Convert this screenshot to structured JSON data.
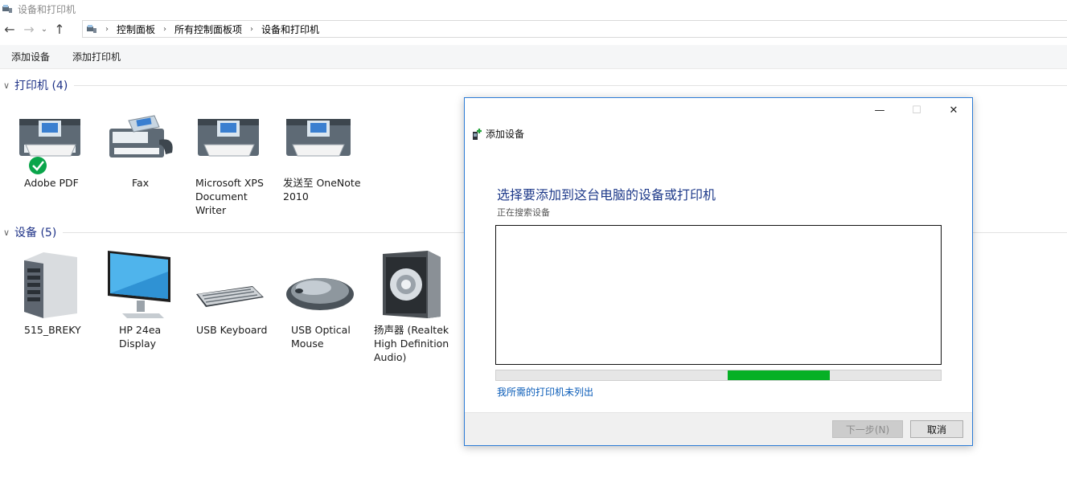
{
  "window": {
    "title": "设备和打印机"
  },
  "address": {
    "crumbs": [
      "控制面板",
      "所有控制面板项",
      "设备和打印机"
    ]
  },
  "commands": {
    "add_device": "添加设备",
    "add_printer": "添加打印机"
  },
  "printers": {
    "header": "打印机 (4)",
    "items": [
      {
        "label": "Adobe PDF"
      },
      {
        "label": "Fax"
      },
      {
        "label": "Microsoft XPS Document Writer"
      },
      {
        "label": "发送至 OneNote 2010"
      }
    ]
  },
  "devices": {
    "header": "设备 (5)",
    "items": [
      {
        "label": "515_BREKY"
      },
      {
        "label": "HP 24ea Display"
      },
      {
        "label": "USB Keyboard"
      },
      {
        "label": "USB Optical Mouse"
      },
      {
        "label": "扬声器 (Realtek High Definition Audio)"
      }
    ]
  },
  "dialog": {
    "title": "添加设备",
    "heading": "选择要添加到这台电脑的设备或打印机",
    "status": "正在搜索设备",
    "link": "我所需的打印机未列出",
    "next_label": "下一步(N)",
    "cancel_label": "取消",
    "progress": {
      "start": 0.52,
      "end": 0.75
    }
  },
  "colors": {
    "accent": "#1e3287",
    "progress": "#06b025",
    "link": "#0a5cb8"
  }
}
